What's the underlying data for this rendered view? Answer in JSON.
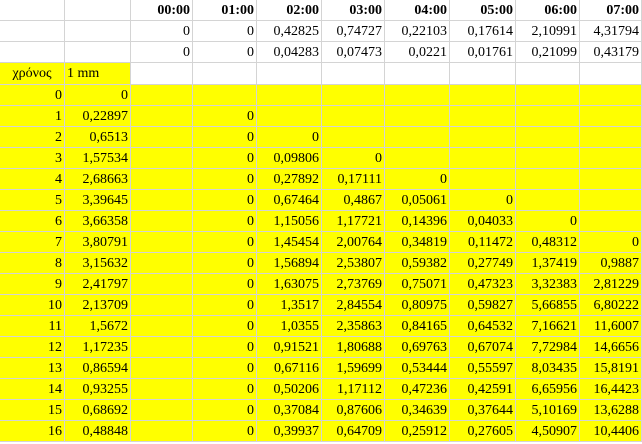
{
  "header": {
    "times": [
      "00:00",
      "01:00",
      "02:00",
      "03:00",
      "04:00",
      "05:00",
      "06:00",
      "07:00"
    ]
  },
  "top_rows": [
    [
      "",
      "",
      "0",
      "0",
      "0,42825",
      "0,74727",
      "0,22103",
      "0,17614",
      "2,10991",
      "4,31794"
    ],
    [
      "",
      "",
      "0",
      "0",
      "0,04283",
      "0,07473",
      "0,0221",
      "0,01761",
      "0,21099",
      "0,43179"
    ]
  ],
  "label_row": [
    "χρόνος",
    "1 mm",
    "",
    "",
    "",
    "",
    "",
    "",
    "",
    ""
  ],
  "data_rows": [
    [
      "0",
      "0",
      "",
      "",
      "",
      "",
      "",
      "",
      "",
      ""
    ],
    [
      "1",
      "0,22897",
      "",
      "0",
      "",
      "",
      "",
      "",
      "",
      ""
    ],
    [
      "2",
      "0,6513",
      "",
      "0",
      "0",
      "",
      "",
      "",
      "",
      ""
    ],
    [
      "3",
      "1,57534",
      "",
      "0",
      "0,09806",
      "0",
      "",
      "",
      "",
      ""
    ],
    [
      "4",
      "2,68663",
      "",
      "0",
      "0,27892",
      "0,17111",
      "0",
      "",
      "",
      ""
    ],
    [
      "5",
      "3,39645",
      "",
      "0",
      "0,67464",
      "0,4867",
      "0,05061",
      "0",
      "",
      ""
    ],
    [
      "6",
      "3,66358",
      "",
      "0",
      "1,15056",
      "1,17721",
      "0,14396",
      "0,04033",
      "0",
      ""
    ],
    [
      "7",
      "3,80791",
      "",
      "0",
      "1,45454",
      "2,00764",
      "0,34819",
      "0,11472",
      "0,48312",
      "0"
    ],
    [
      "8",
      "3,15632",
      "",
      "0",
      "1,56894",
      "2,53807",
      "0,59382",
      "0,27749",
      "1,37419",
      "0,9887"
    ],
    [
      "9",
      "2,41797",
      "",
      "0",
      "1,63075",
      "2,73769",
      "0,75071",
      "0,47323",
      "3,32383",
      "2,81229"
    ],
    [
      "10",
      "2,13709",
      "",
      "0",
      "1,3517",
      "2,84554",
      "0,80975",
      "0,59827",
      "5,66855",
      "6,80222"
    ],
    [
      "11",
      "1,5672",
      "",
      "0",
      "1,0355",
      "2,35863",
      "0,84165",
      "0,64532",
      "7,16621",
      "11,6007"
    ],
    [
      "12",
      "1,17235",
      "",
      "0",
      "0,91521",
      "1,80688",
      "0,69763",
      "0,67074",
      "7,72984",
      "14,6656"
    ],
    [
      "13",
      "0,86594",
      "",
      "0",
      "0,67116",
      "1,59699",
      "0,53444",
      "0,55597",
      "8,03435",
      "15,8191"
    ],
    [
      "14",
      "0,93255",
      "",
      "0",
      "0,50206",
      "1,17112",
      "0,47236",
      "0,42591",
      "6,65956",
      "16,4423"
    ],
    [
      "15",
      "0,68692",
      "",
      "0",
      "0,37084",
      "0,87606",
      "0,34639",
      "0,37644",
      "5,10169",
      "13,6288"
    ],
    [
      "16",
      "0,48848",
      "",
      "0",
      "0,39937",
      "0,64709",
      "0,25912",
      "0,27605",
      "4,50907",
      "10,4406"
    ]
  ],
  "colors": {
    "highlight": "#ffff00",
    "gridline": "#d4d4d4"
  }
}
